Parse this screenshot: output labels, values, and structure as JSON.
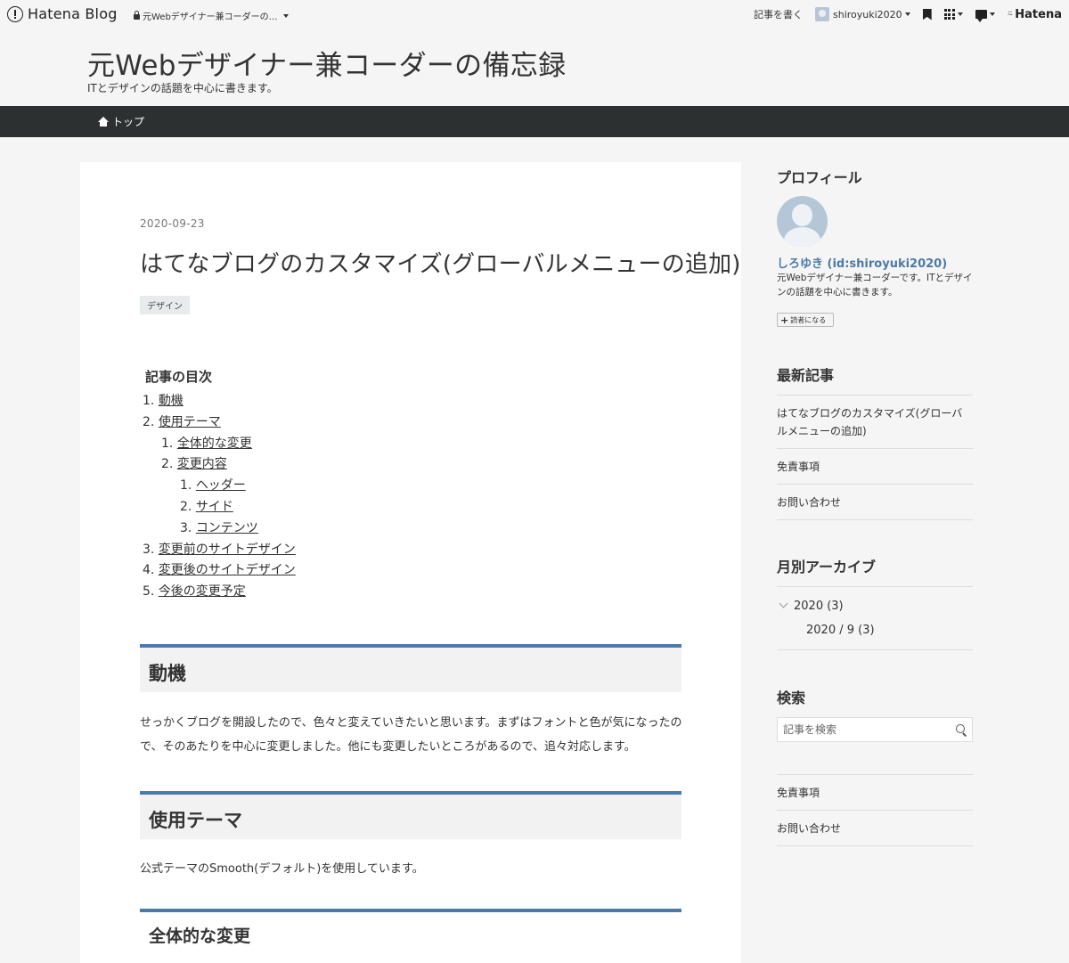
{
  "topbar": {
    "logo": "Hatena Blog",
    "blog_select": "元Webデザイナー兼コーダーの…",
    "write": "記事を書く",
    "user": "shiroyuki2020",
    "brand": "Hatena"
  },
  "header": {
    "title": "元Webデザイナー兼コーダーの備忘録",
    "description": "ITとデザインの話題を中心に書きます。"
  },
  "nav": {
    "home": "トップ"
  },
  "article": {
    "date": "2020-09-23",
    "title": "はてなブログのカスタマイズ(グローバルメニューの追加)",
    "category": "デザイン",
    "toc_title": "記事の目次",
    "toc": [
      {
        "label": "1. ",
        "link": "動機"
      },
      {
        "label": "2. ",
        "link": "使用テーマ"
      },
      {
        "label": "1. ",
        "link": "全体的な変更"
      },
      {
        "label": "2. ",
        "link": "変更内容"
      },
      {
        "label": "1. ",
        "link": "ヘッダー"
      },
      {
        "label": "2. ",
        "link": "サイド"
      },
      {
        "label": "3. ",
        "link": "コンテンツ"
      },
      {
        "label": "3. ",
        "link": "変更前のサイトデザイン"
      },
      {
        "label": "4. ",
        "link": "変更後のサイトデザイン"
      },
      {
        "label": "5. ",
        "link": "今後の変更予定"
      }
    ],
    "h_motive": "動機",
    "p_motive": "せっかくブログを開設したので、色々と変えていきたいと思います。まずはフォントと色が気になったので、そのあたりを中心に変更しました。他にも変更したいところがあるので、追々対応します。",
    "h_theme": "使用テーマ",
    "p_theme": "公式テーマのSmooth(デフォルト)を使用しています。",
    "h_overall": "全体的な変更"
  },
  "sidebar": {
    "profile_title": "プロフィール",
    "profile_name": "しろゆき (id:shiroyuki2020)",
    "profile_desc": "元Webデザイナー兼コーダーです。ITとデザインの話題を中心に書きます。",
    "subscribe": "読者になる",
    "recent_title": "最新記事",
    "recent": [
      "はてなブログのカスタマイズ(グローバルメニューの追加)",
      "免責事項",
      "お問い合わせ"
    ],
    "archive_title": "月別アーカイブ",
    "archive_year": "2020 (3)",
    "archive_month": "2020 / 9 (3)",
    "search_title": "検索",
    "search_placeholder": "記事を検索",
    "links": [
      "免責事項",
      "お問い合わせ"
    ]
  },
  "colors": {
    "accent": "#4c7aa8",
    "nav_bg": "#2c3031"
  }
}
